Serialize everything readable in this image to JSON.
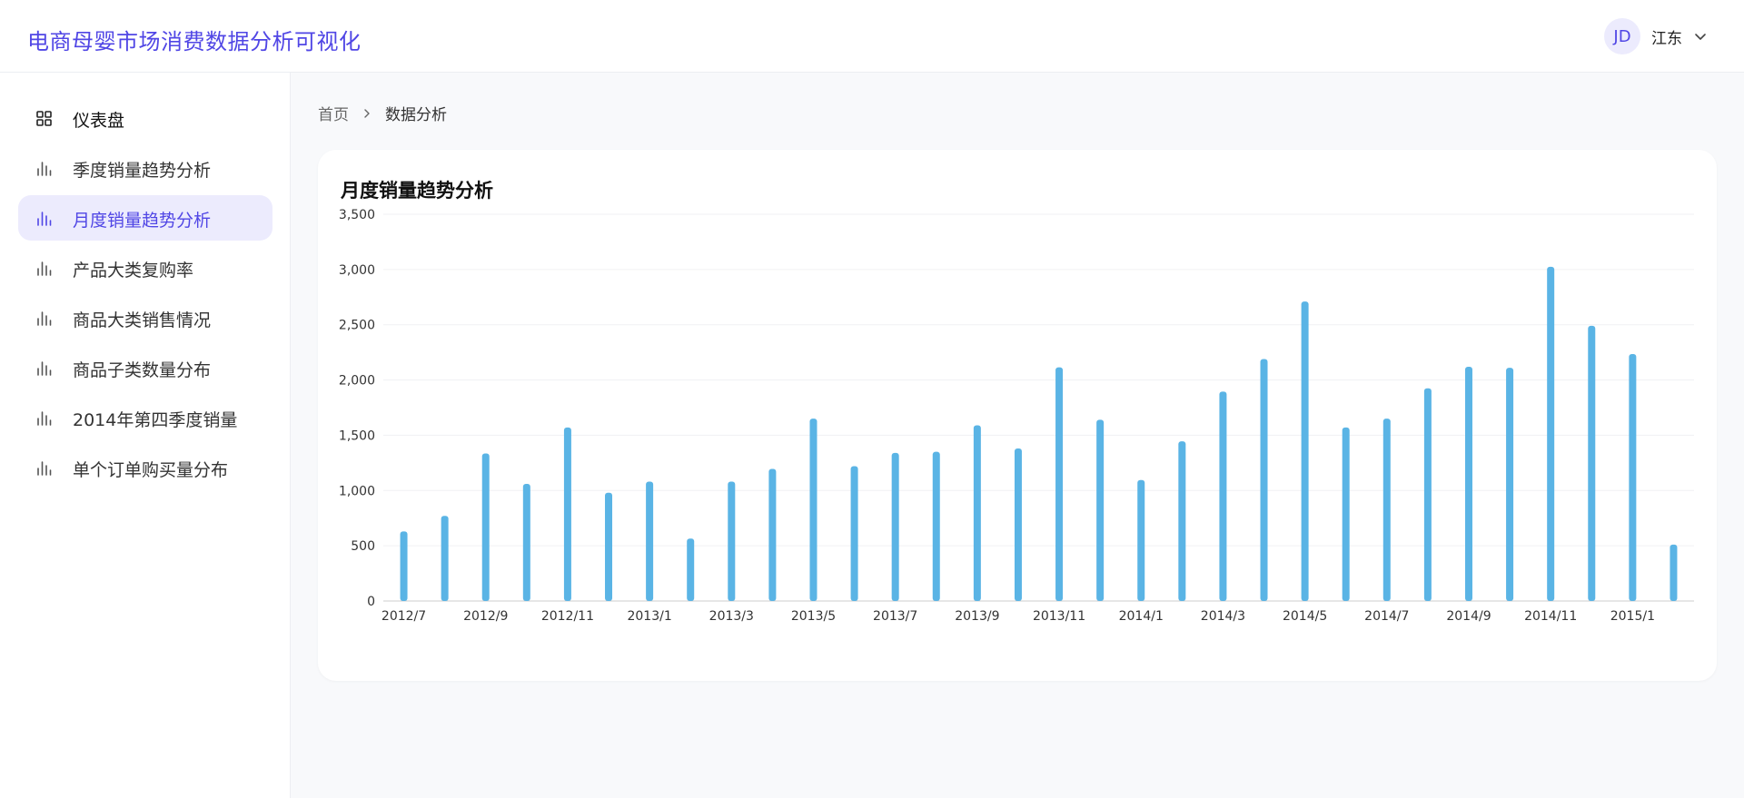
{
  "header": {
    "app_title": "电商母婴市场消费数据分析可视化",
    "user": {
      "avatar_initials": "JD",
      "name": "江东"
    }
  },
  "sidebar": {
    "items": [
      {
        "label": "仪表盘",
        "icon": "dashboard-grid-icon",
        "active": false
      },
      {
        "label": "季度销量趋势分析",
        "icon": "bar-chart-icon",
        "active": false
      },
      {
        "label": "月度销量趋势分析",
        "icon": "bar-chart-icon",
        "active": true
      },
      {
        "label": "产品大类复购率",
        "icon": "bar-chart-icon",
        "active": false
      },
      {
        "label": "商品大类销售情况",
        "icon": "bar-chart-icon",
        "active": false
      },
      {
        "label": "商品子类数量分布",
        "icon": "bar-chart-icon",
        "active": false
      },
      {
        "label": "2014年第四季度销量",
        "icon": "bar-chart-icon",
        "active": false
      },
      {
        "label": "单个订单购买量分布",
        "icon": "bar-chart-icon",
        "active": false
      }
    ]
  },
  "breadcrumb": {
    "home": "首页",
    "current": "数据分析"
  },
  "card": {
    "title": "月度销量趋势分析"
  },
  "colors": {
    "accent": "#5046e5",
    "bar": "#5ab4e5",
    "active_bg": "#ecebfd"
  },
  "chart_data": {
    "type": "bar",
    "title": "月度销量趋势分析",
    "xlabel": "",
    "ylabel": "",
    "ylim": [
      0,
      3500
    ],
    "yticks": [
      0,
      500,
      1000,
      1500,
      2000,
      2500,
      3000,
      3500
    ],
    "ytick_labels": [
      "0",
      "500",
      "1,000",
      "1,500",
      "2,000",
      "2,500",
      "3,000",
      "3,500"
    ],
    "categories": [
      "2012/7",
      "2012/8",
      "2012/9",
      "2012/10",
      "2012/11",
      "2012/12",
      "2013/1",
      "2013/2",
      "2013/3",
      "2013/4",
      "2013/5",
      "2013/6",
      "2013/7",
      "2013/8",
      "2013/9",
      "2013/10",
      "2013/11",
      "2013/12",
      "2014/1",
      "2014/2",
      "2014/3",
      "2014/4",
      "2014/5",
      "2014/6",
      "2014/7",
      "2014/8",
      "2014/9",
      "2014/10",
      "2014/11",
      "2014/12",
      "2015/1",
      "2015/2"
    ],
    "xtick_labels_shown": [
      "2012/7",
      "2012/9",
      "2012/11",
      "2013/1",
      "2013/3",
      "2013/5",
      "2013/7",
      "2013/9",
      "2013/11",
      "2014/1",
      "2014/3",
      "2014/5",
      "2014/7",
      "2014/9",
      "2014/11",
      "2015/1"
    ],
    "values": [
      630,
      770,
      1335,
      1060,
      1570,
      980,
      1080,
      565,
      1080,
      1195,
      1650,
      1220,
      1340,
      1350,
      1590,
      1380,
      2115,
      1640,
      1095,
      1445,
      1895,
      2190,
      2710,
      1570,
      1650,
      1925,
      2120,
      2110,
      3025,
      2490,
      2235,
      510
    ],
    "grid": true,
    "legend": "none"
  }
}
